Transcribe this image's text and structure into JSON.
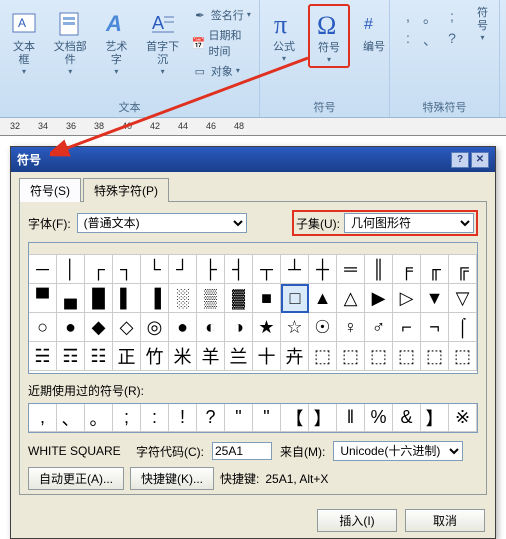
{
  "ribbon": {
    "groups": {
      "text": {
        "label": "文本",
        "textbox": "文本框",
        "docparts": "文档部件",
        "wordart": "艺术字",
        "dropcap": "首字下沉",
        "signature": "签名行",
        "datetime": "日期和时间",
        "object": "对象"
      },
      "symbols": {
        "label": "符号",
        "equation": "公式",
        "symbol": "符号",
        "number": "编号"
      },
      "special": {
        "label": "特殊符号",
        "symbol": "符号"
      }
    }
  },
  "ruler": {
    "marks": [
      32,
      34,
      36,
      38,
      40,
      42,
      44,
      46,
      48
    ]
  },
  "dialog": {
    "title": "符号",
    "tabs": {
      "symbols": "符号(S)",
      "special": "特殊字符(P)"
    },
    "font_label": "字体(F):",
    "font_value": "(普通文本)",
    "subset_label": "子集(U):",
    "subset_value": "几何图形符",
    "recent_label": "近期使用过的符号(R):",
    "char_name": "WHITE SQUARE",
    "code_label": "字符代码(C):",
    "code_value": "25A1",
    "from_label": "来自(M):",
    "from_value": "Unicode(十六进制)",
    "autocorrect": "自动更正(A)...",
    "shortcut_btn": "快捷键(K)...",
    "shortcut_label": "快捷键:",
    "shortcut_value": "25A1, Alt+X",
    "insert": "插入(I)",
    "cancel": "取消"
  },
  "symbols_row1": [
    "─",
    "│",
    "┌",
    "┐",
    "└",
    "┘",
    "├",
    "┤",
    "┬",
    "┴",
    "┼",
    "═",
    "║",
    "╒",
    "╓",
    "╔"
  ],
  "symbols_row2": [
    "▀",
    "▄",
    "█",
    "▌",
    "▐",
    "░",
    "▒",
    "▓",
    "■",
    "□",
    "▲",
    "△",
    "▶",
    "▷",
    "▼",
    "▽"
  ],
  "symbols_row3": [
    "○",
    "●",
    "◆",
    "◇",
    "◎",
    "●",
    "◐",
    "◑",
    "★",
    "☆",
    "☉",
    "♀",
    "♂",
    "⌐",
    "¬",
    "⌠"
  ],
  "symbols_row4": [
    "☵",
    "☶",
    "☷",
    "正",
    "竹",
    "米",
    "羊",
    "兰",
    "十",
    "卉",
    "⬚",
    "⬚",
    "⬚",
    "⬚",
    "⬚",
    "⬚"
  ],
  "recent_symbols": [
    ",",
    "、",
    "。",
    ";",
    ":",
    "!",
    "?",
    "\"",
    "\"",
    "【",
    "】",
    "‖",
    "%",
    "&",
    "】",
    "※"
  ],
  "selected_index": 25
}
